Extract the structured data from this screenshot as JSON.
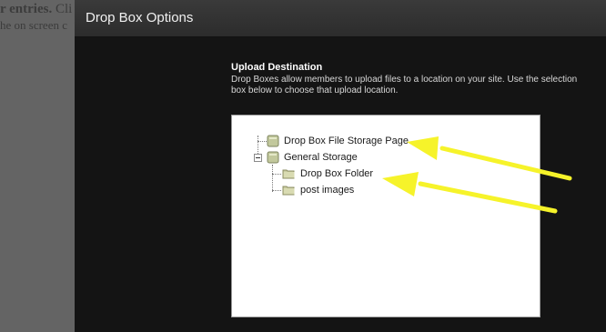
{
  "background": {
    "line1_bold": "r entries.",
    "line1_rest": "Cli",
    "line2": "he on screen c"
  },
  "modal": {
    "title": "Drop Box Options",
    "section_heading": "Upload Destination",
    "section_description": "Drop Boxes allow members to upload files to a location on your site. Use the selection box below to choose that upload location."
  },
  "tree": {
    "nodes": [
      {
        "label": "Drop Box File Storage Page",
        "icon": "page-icon",
        "level": 0
      },
      {
        "label": "General Storage",
        "icon": "page-icon",
        "level": 0,
        "expanded": true
      },
      {
        "label": "Drop Box Folder",
        "icon": "folder-icon",
        "level": 1
      },
      {
        "label": "post images",
        "icon": "folder-icon",
        "level": 1
      }
    ]
  },
  "annotation": {
    "arrow_color": "#f6f32a"
  }
}
